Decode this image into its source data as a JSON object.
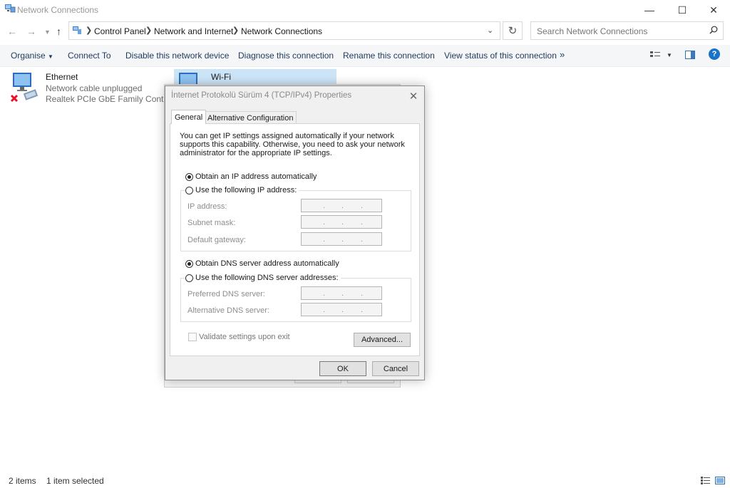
{
  "window": {
    "title": "Network Connections"
  },
  "address": {
    "crumbs": [
      "Control Panel",
      "Network and Internet",
      "Network Connections"
    ],
    "search_placeholder": "Search Network Connections"
  },
  "commands": [
    "Organise",
    "Connect To",
    "Disable this network device",
    "Diagnose this connection",
    "Rename this connection",
    "View status of this connection",
    "»"
  ],
  "items": [
    {
      "name": "Ethernet",
      "status": "Network cable unplugged",
      "device": "Realtek PCIe GbE Family Controller"
    },
    {
      "name": "Wi-Fi"
    }
  ],
  "dialog": {
    "title": "İnternet Protokolü Sürüm 4 (TCP/IPv4) Properties",
    "tabs": [
      "General",
      "Alternative Configuration"
    ],
    "description": "You can get IP settings assigned automatically if your network supports this capability. Otherwise, you need to ask your network administrator for the appropriate IP settings.",
    "ip_auto": "Obtain an IP address automatically",
    "ip_manual": "Use the following IP address:",
    "ip_fields": [
      "IP address:",
      "Subnet mask:",
      "Default gateway:"
    ],
    "dns_auto": "Obtain DNS server address automatically",
    "dns_manual": "Use the following DNS server addresses:",
    "dns_fields": [
      "Preferred DNS server:",
      "Alternative DNS server:"
    ],
    "validate": "Validate settings upon exit",
    "advanced": "Advanced...",
    "ok": "OK",
    "cancel": "Cancel",
    "ip_auto_selected": true,
    "dns_auto_selected": true
  },
  "status": {
    "count": "2 items",
    "selected": "1 item selected"
  },
  "colors": {
    "accent": "#1e395b",
    "help": "#1a73c9",
    "error": "#e81123"
  }
}
